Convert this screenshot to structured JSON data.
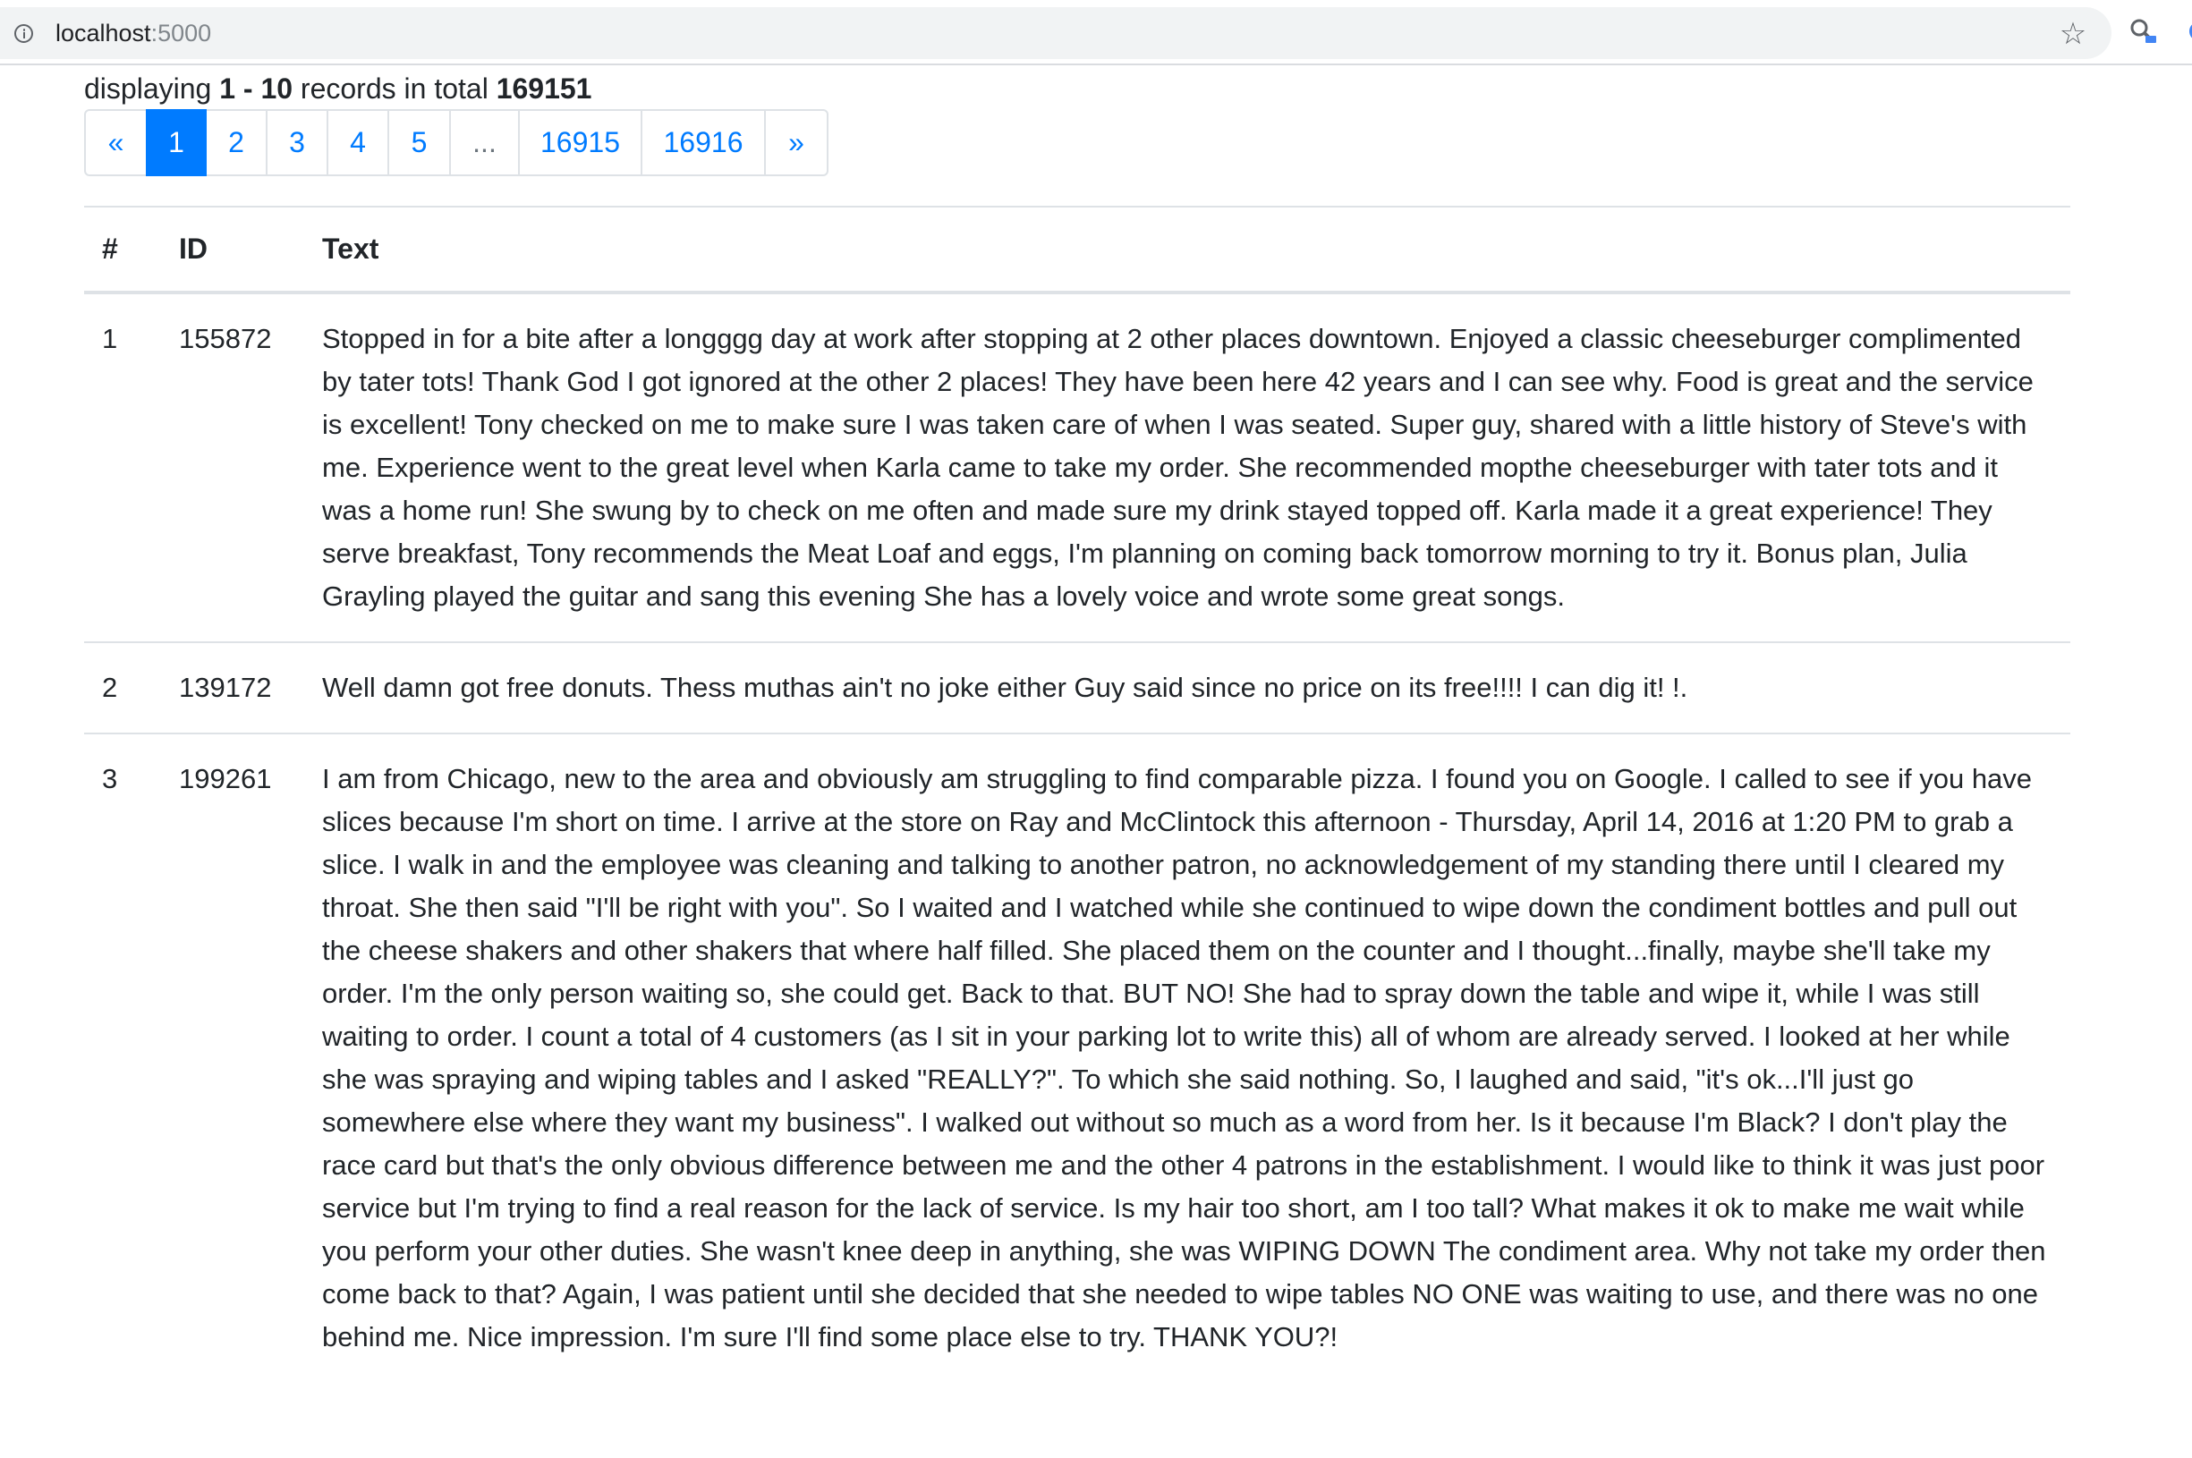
{
  "browser": {
    "url_host": "localhost",
    "url_port": ":5000",
    "icons": [
      "info-icon",
      "star-icon",
      "extension-icon"
    ]
  },
  "summary": {
    "prefix": "displaying",
    "range": "1 - 10",
    "middle": "records in total",
    "total": "169151"
  },
  "pagination": {
    "prev": "«",
    "pages": [
      "1",
      "2",
      "3",
      "4",
      "5"
    ],
    "ellipsis": "...",
    "last_pages": [
      "16915",
      "16916"
    ],
    "next": "»",
    "active": "1"
  },
  "table": {
    "headers": [
      "#",
      "ID",
      "Text"
    ],
    "rows": [
      {
        "num": "1",
        "id": "155872",
        "text": "Stopped in for a bite after a longggg day at work after stopping at 2 other places downtown. Enjoyed a classic cheeseburger complimented by tater tots! Thank God I got ignored at the other 2 places! They have been here 42 years and I can see why. Food is great and the service is excellent! Tony checked on me to make sure I was taken care of when I was seated. Super guy, shared with a little history of Steve's with me. Experience went to the great level when Karla came to take my order. She recommended mopthe cheeseburger with tater tots and it was a home run! She swung by to check on me often and made sure my drink stayed topped off. Karla made it a great experience! They serve breakfast, Tony recommends the Meat Loaf and eggs, I'm planning on coming back tomorrow morning to try it. Bonus plan, Julia Grayling played the guitar and sang this evening She has a lovely voice and wrote some great songs."
      },
      {
        "num": "2",
        "id": "139172",
        "text": "Well damn got free donuts. Thess muthas ain't no joke either Guy said since no price on its free!!!! I can dig it! !."
      },
      {
        "num": "3",
        "id": "199261",
        "text": "I am from Chicago, new to the area and obviously am struggling to find comparable pizza. I found you on Google. I called to see if you have slices because I'm short on time. I arrive at the store on Ray and McClintock this afternoon - Thursday, April 14, 2016 at 1:20 PM to grab a slice. I walk in and the employee was cleaning and talking to another patron, no acknowledgement of my standing there until I cleared my throat. She then said \"I'll be right with you\". So I waited and I watched while she continued to wipe down the condiment bottles and pull out the cheese shakers and other shakers that where half filled. She placed them on the counter and I thought...finally, maybe she'll take my order. I'm the only person waiting so, she could get. Back to that. BUT NO! She had to spray down the table and wipe it, while I was still waiting to order. I count a total of 4 customers (as I sit in your parking lot to write this) all of whom are already served. I looked at her while she was spraying and wiping tables and I asked \"REALLY?\". To which she said nothing. So, I laughed and said, \"it's ok...I'll just go somewhere else where they want my business\". I walked out without so much as a word from her. Is it because I'm Black? I don't play the race card but that's the only obvious difference between me and the other 4 patrons in the establishment. I would like to think it was just poor service but I'm trying to find a real reason for the lack of service. Is my hair too short, am I too tall? What makes it ok to make me wait while you perform your other duties. She wasn't knee deep in anything, she was WIPING DOWN The condiment area. Why not take my order then come back to that? Again, I was patient until she decided that she needed to wipe tables NO ONE was waiting to use, and there was no one behind me. Nice impression. I'm sure I'll find some place else to try. THANK YOU?!"
      }
    ]
  }
}
